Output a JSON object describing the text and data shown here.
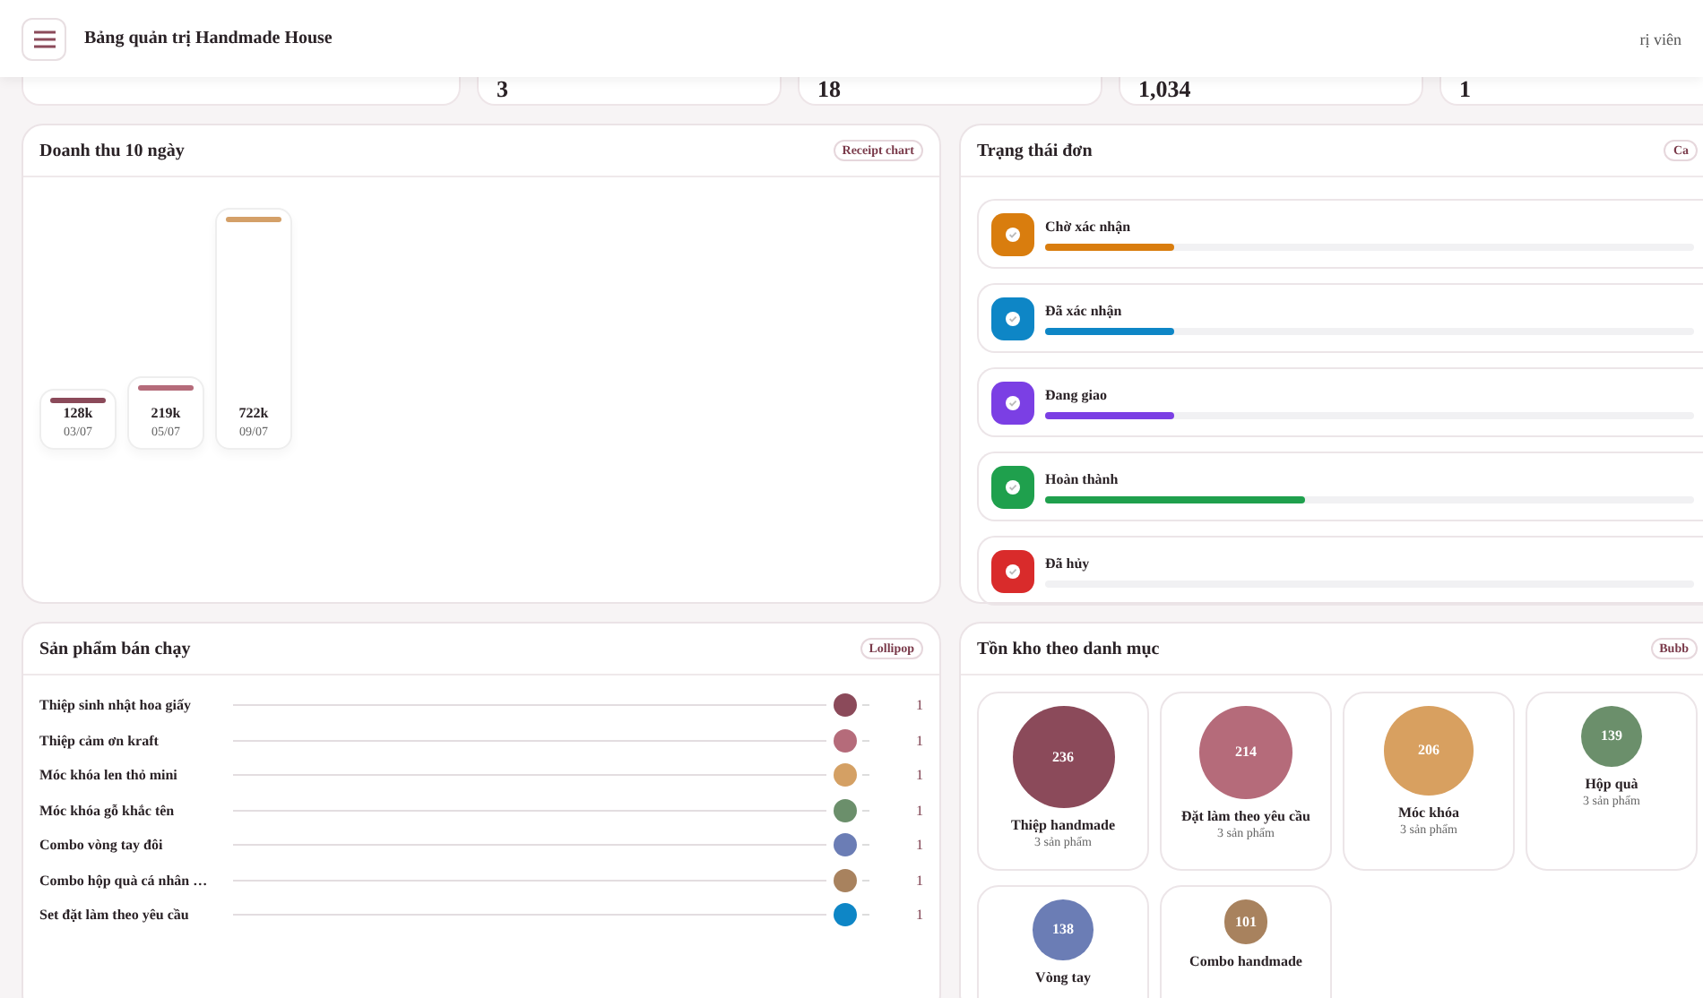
{
  "header": {
    "title": "Bảng quản trị Handmade House",
    "user_label": "rị viên"
  },
  "stats": [
    {
      "value": "3"
    },
    {
      "value": "18"
    },
    {
      "value": "1,034"
    },
    {
      "value": "1"
    }
  ],
  "revenue": {
    "title": "Doanh thu 10 ngày",
    "badge": "Receipt chart",
    "bars": [
      {
        "amount": "128k",
        "date": "03/07",
        "color": "#8b4a5a"
      },
      {
        "amount": "219k",
        "date": "05/07",
        "color": "#b56b7a"
      },
      {
        "amount": "722k",
        "date": "09/07",
        "color": "#d4a068"
      }
    ]
  },
  "order_status": {
    "title": "Trạng thái đơn",
    "badge": "Ca",
    "items": [
      {
        "label": "Chờ xác nhận",
        "level": 0.2,
        "color": "#d97d0e"
      },
      {
        "label": "Đã xác nhận",
        "level": 0.2,
        "color": "#0e86c6"
      },
      {
        "label": "Đang giao",
        "level": 0.2,
        "color": "#7b3fe4"
      },
      {
        "label": "Hoàn thành",
        "level": 0.4,
        "color": "#1fa04d"
      },
      {
        "label": "Đã hủy",
        "level": 0,
        "color": "#d92b2b"
      }
    ]
  },
  "best_sellers": {
    "title": "Sản phẩm bán chạy",
    "badge": "Lollipop",
    "items": [
      {
        "name": "Thiệp sinh nhật hoa giấy",
        "count": "1",
        "color": "#8b4a5a"
      },
      {
        "name": "Thiệp cảm ơn kraft",
        "count": "1",
        "color": "#b56b7a"
      },
      {
        "name": "Móc khóa len thỏ mini",
        "count": "1",
        "color": "#d4a064"
      },
      {
        "name": "Móc khóa gỗ khắc tên",
        "count": "1",
        "color": "#6b8f6b"
      },
      {
        "name": "Combo vòng tay đôi",
        "count": "1",
        "color": "#6b7db5"
      },
      {
        "name": "Combo hộp quà cá nhân …",
        "count": "1",
        "color": "#a8825e"
      },
      {
        "name": "Set đặt làm theo yêu cầu",
        "count": "1",
        "color": "#0e86c6"
      }
    ]
  },
  "inventory": {
    "title": "Tồn kho theo danh mục",
    "badge": "Bubb",
    "items": [
      {
        "value": "236",
        "name": "Thiệp handmade",
        "sub": "3 sản phẩm",
        "color": "#8b4a5a"
      },
      {
        "value": "214",
        "name": "Đặt làm theo yêu cầu",
        "sub": "3 sản phẩm",
        "color": "#b56b7a"
      },
      {
        "value": "206",
        "name": "Móc khóa",
        "sub": "3 sản phẩm",
        "color": "#d8a060"
      },
      {
        "value": "139",
        "name": "Hộp quà",
        "sub": "3 sản phẩm",
        "color": "#6b8f6b"
      },
      {
        "value": "138",
        "name": "Vòng tay",
        "color": "#6b7db5"
      },
      {
        "value": "101",
        "name": "Combo handmade",
        "color": "#a8825e"
      }
    ]
  }
}
